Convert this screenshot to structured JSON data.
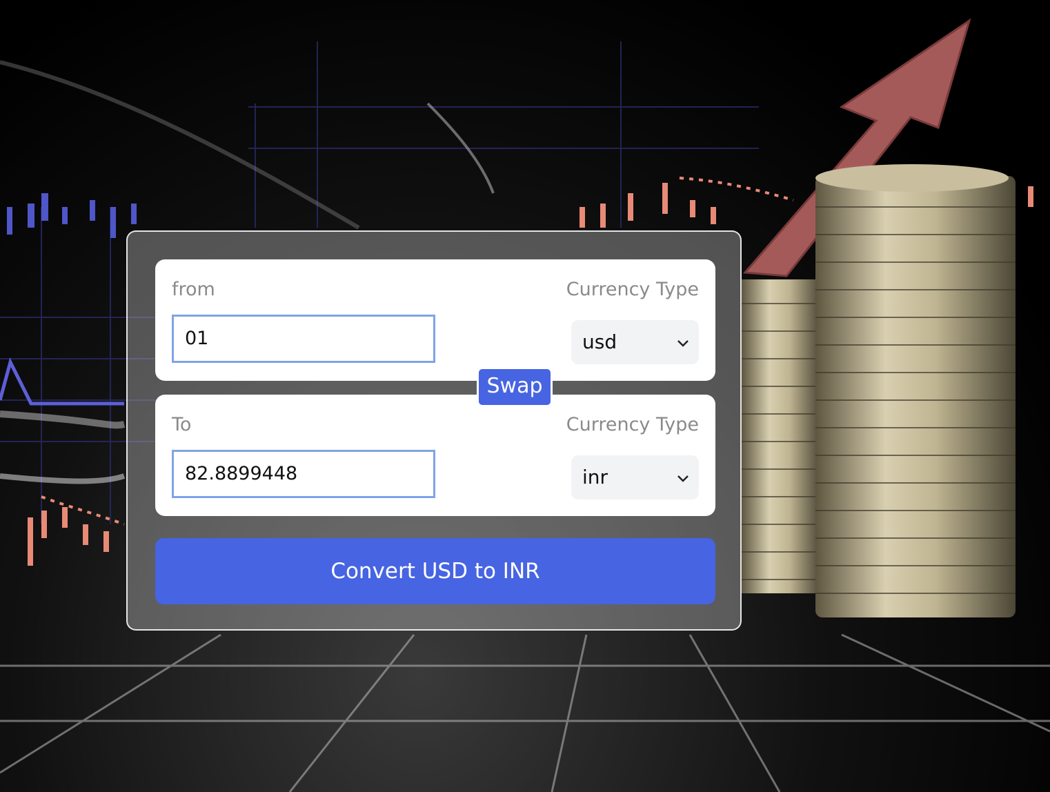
{
  "converter": {
    "from": {
      "label": "from",
      "currency_type_label": "Currency Type",
      "amount": "01",
      "currency": "usd"
    },
    "to": {
      "label": "To",
      "currency_type_label": "Currency Type",
      "amount": "82.8899448",
      "currency": "inr"
    },
    "swap_label": "Swap",
    "convert_label": "Convert USD to INR"
  },
  "colors": {
    "accent": "#4764e2",
    "input_border": "#7fa3e6",
    "select_bg": "#f2f3f5",
    "label_gray": "#8a8a8a"
  },
  "icons": {
    "select_arrow": "chevron-down-icon"
  }
}
